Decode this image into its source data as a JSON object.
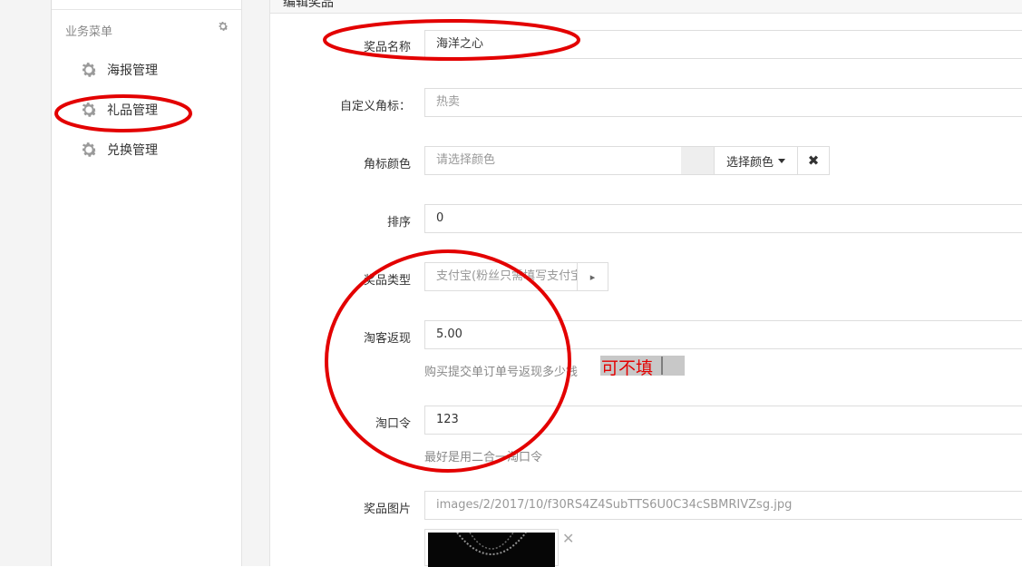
{
  "sidebar": {
    "title": "业务菜单",
    "items": [
      {
        "label": "海报管理",
        "icon": "gear-icon"
      },
      {
        "label": "礼品管理",
        "icon": "gear-icon"
      },
      {
        "label": "兑换管理",
        "icon": "gear-icon"
      }
    ]
  },
  "main": {
    "header_title": "编辑奖品"
  },
  "form": {
    "prize_name": {
      "label": "奖品名称",
      "value": "海洋之心"
    },
    "custom_tag": {
      "label": "自定义角标：",
      "placeholder": "热卖"
    },
    "tag_color": {
      "label": "角标颜色",
      "placeholder": "请选择颜色",
      "button_label": "选择颜色",
      "clear_icon": "close-icon"
    },
    "sort": {
      "label": "排序",
      "value": "0"
    },
    "prize_type": {
      "label": "奖品类型",
      "value": "支付宝(粉丝只需填写支付宝)"
    },
    "taoke_cashback": {
      "label": "淘客返现",
      "value": "5.00",
      "help": "购买提交单订单号返现多少钱"
    },
    "tao_password": {
      "label": "淘口令",
      "value": "123",
      "help": "最好是用二合一淘口令"
    },
    "prize_image": {
      "label": "奖品图片",
      "value": "images/2/2017/10/f30RS4Z4SubTTS6U0C34cSBMRIVZsg.jpg"
    }
  },
  "annotation": {
    "note": "可不填",
    "color": "#e30000"
  }
}
